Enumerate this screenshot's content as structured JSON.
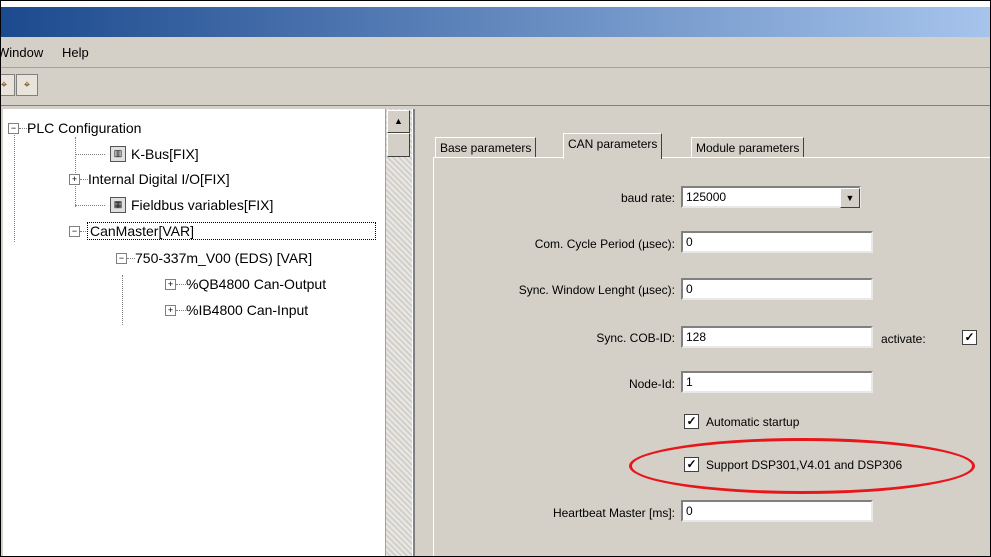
{
  "menu": {
    "window": "Window",
    "help": "Help"
  },
  "toolbar": {
    "btn1_icon": "binoculars-icon",
    "btn2_icon": "find-next-icon"
  },
  "tree": {
    "root": "PLC Configuration",
    "kbus": "K-Bus[FIX]",
    "internal_io": "Internal Digital I/O[FIX]",
    "fieldbus_vars": "Fieldbus variables[FIX]",
    "canmaster": "CanMaster[VAR]",
    "module": "750-337m_V00 (EDS)  [VAR]",
    "qb": "%QB4800 Can-Output",
    "ib": "%IB4800 Can-Input"
  },
  "tabs": [
    {
      "label": "Base parameters"
    },
    {
      "label": "CAN parameters"
    },
    {
      "label": "Module parameters"
    }
  ],
  "form": {
    "baud_rate_label": "baud rate:",
    "baud_rate_value": "125000",
    "com_cycle_label": "Com. Cycle Period (µsec):",
    "com_cycle_value": "0",
    "sync_window_label": "Sync. Window Lenght (µsec):",
    "sync_window_value": "0",
    "sync_cob_label": "Sync. COB-ID:",
    "sync_cob_value": "128",
    "activate_label": "activate:",
    "node_id_label": "Node-Id:",
    "node_id_value": "1",
    "auto_startup_label": "Automatic startup",
    "support_dsp_label": "Support DSP301,V4.01 and DSP306",
    "heartbeat_label": "Heartbeat Master [ms]:",
    "heartbeat_value": "0"
  },
  "checks": {
    "activate": "✓",
    "auto_startup": "✓",
    "support_dsp": "✓"
  },
  "colors": {
    "highlight": "#e8161b",
    "title_start": "#1c4a8e",
    "title_end": "#a6c4ec"
  }
}
